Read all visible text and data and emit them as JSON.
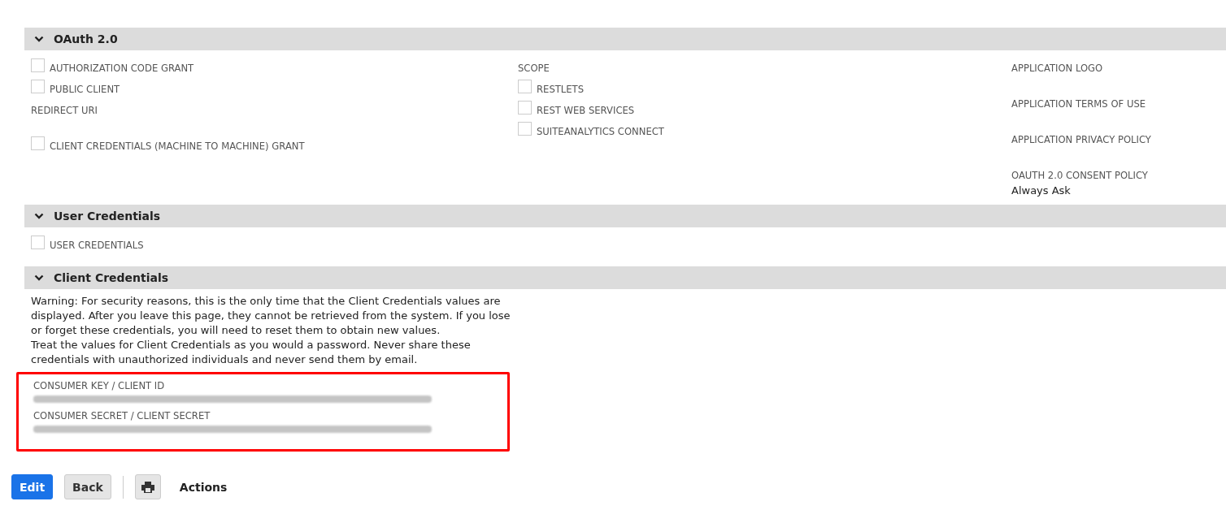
{
  "sections": [
    {
      "kind": "columns",
      "title": "OAuth 2.0",
      "expanded": true,
      "columns": [
        {
          "items": [
            {
              "kind": "checkbox",
              "label": "AUTHORIZATION CODE GRANT",
              "checked": false
            },
            {
              "kind": "checkbox",
              "label": "PUBLIC CLIENT",
              "checked": false
            },
            {
              "kind": "field",
              "label": "REDIRECT URI"
            },
            {
              "kind": "checkbox",
              "label": "CLIENT CREDENTIALS (MACHINE TO MACHINE) GRANT",
              "checked": false
            }
          ]
        },
        {
          "items": [
            {
              "kind": "label",
              "label": "SCOPE"
            },
            {
              "kind": "checkbox",
              "label": "RESTLETS",
              "checked": false
            },
            {
              "kind": "checkbox",
              "label": "REST WEB SERVICES",
              "checked": false
            },
            {
              "kind": "checkbox",
              "label": "SUITEANALYTICS CONNECT",
              "checked": false
            }
          ]
        },
        {
          "items": [
            {
              "kind": "field",
              "label": "APPLICATION LOGO"
            },
            {
              "kind": "field",
              "label": "APPLICATION TERMS OF USE"
            },
            {
              "kind": "field",
              "label": "APPLICATION PRIVACY POLICY"
            },
            {
              "kind": "field",
              "label": "OAUTH 2.0 CONSENT POLICY",
              "value": "Always Ask"
            }
          ]
        }
      ]
    },
    {
      "kind": "columns",
      "title": "User Credentials",
      "expanded": true,
      "columns": [
        {
          "items": [
            {
              "kind": "checkbox",
              "label": "USER CREDENTIALS",
              "checked": false
            }
          ]
        }
      ]
    },
    {
      "kind": "credentials",
      "title": "Client Credentials",
      "expanded": true,
      "warning": [
        "Warning: For security reasons, this is the only time that the Client Credentials values are displayed. After you leave this page, they cannot be retrieved from the system. If you lose or forget these credentials, you will need to reset them to obtain new values.",
        "Treat the values for Client Credentials as you would a password. Never share these credentials with unauthorized individuals and never send them by email."
      ],
      "highlighted": true,
      "fields": [
        {
          "label": "CONSUMER KEY / CLIENT ID",
          "redacted": true
        },
        {
          "label": "CONSUMER SECRET / CLIENT SECRET",
          "redacted": true
        }
      ]
    }
  ],
  "buttons": [
    {
      "kind": "primary",
      "label": "Edit"
    },
    {
      "kind": "secondary",
      "label": "Back"
    },
    {
      "kind": "print"
    },
    {
      "kind": "menu",
      "label": "Actions"
    }
  ]
}
